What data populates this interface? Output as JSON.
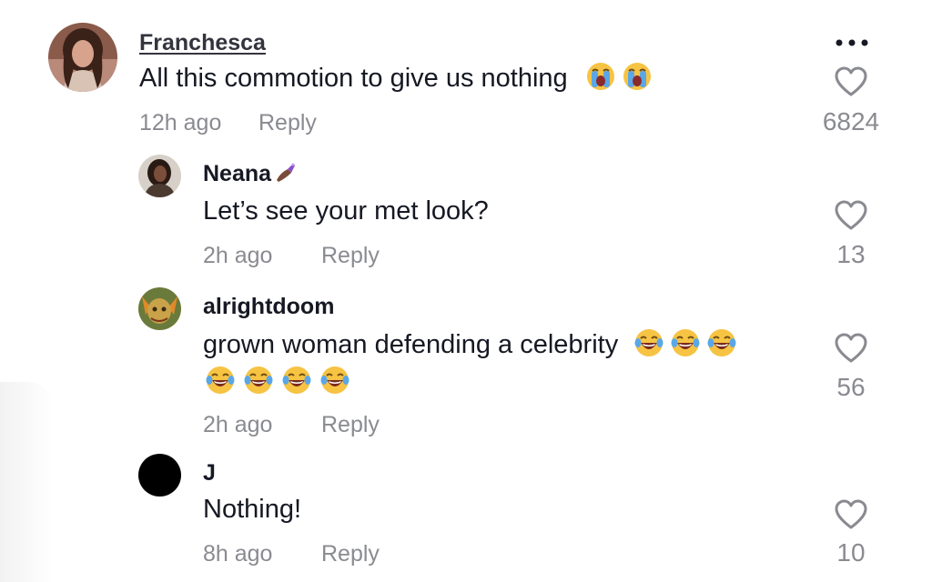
{
  "comments": [
    {
      "username": "Franchesca",
      "text": "All this commotion to give us nothing",
      "emoji": [
        "loudly-crying-face",
        "loudly-crying-face"
      ],
      "time": "12h ago",
      "reply": "Reply",
      "likes": "6824"
    },
    {
      "username": "Neana",
      "text": "Let’s see your met look?",
      "time": "2h ago",
      "reply": "Reply",
      "likes": "13"
    },
    {
      "username": "alrightdoom",
      "text": "grown woman defending a celebrity",
      "emoji": [
        "face-with-tears-of-joy",
        "face-with-tears-of-joy",
        "face-with-tears-of-joy",
        "face-with-tears-of-joy",
        "face-with-tears-of-joy",
        "face-with-tears-of-joy",
        "face-with-tears-of-joy"
      ],
      "time": "2h ago",
      "reply": "Reply",
      "likes": "56"
    },
    {
      "username": "J",
      "text": "Nothing!",
      "time": "8h ago",
      "reply": "Reply",
      "likes": "10"
    }
  ],
  "colors": {
    "text_primary": "#161823",
    "text_secondary": "#8a8b91",
    "heart_outline": "#8a8b91"
  }
}
